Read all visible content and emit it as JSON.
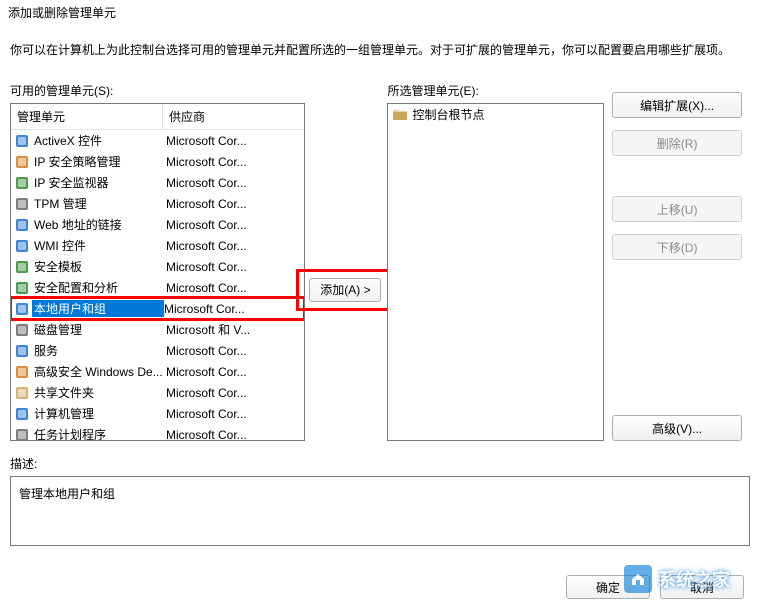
{
  "dialog": {
    "title": "添加或删除管理单元",
    "instruction": "你可以在计算机上为此控制台选择可用的管理单元并配置所选的一组管理单元。对于可扩展的管理单元，你可以配置要启用哪些扩展项。"
  },
  "available": {
    "label": "可用的管理单元(S):",
    "columns": {
      "name": "管理单元",
      "vendor": "供应商"
    },
    "items": [
      {
        "name": "ActiveX 控件",
        "vendor": "Microsoft Cor...",
        "iconColor": "ic-blue"
      },
      {
        "name": "IP 安全策略管理",
        "vendor": "Microsoft Cor...",
        "iconColor": "ic-orange"
      },
      {
        "name": "IP 安全监视器",
        "vendor": "Microsoft Cor...",
        "iconColor": "ic-green"
      },
      {
        "name": "TPM 管理",
        "vendor": "Microsoft Cor...",
        "iconColor": "ic-gray"
      },
      {
        "name": "Web 地址的链接",
        "vendor": "Microsoft Cor...",
        "iconColor": "ic-blue"
      },
      {
        "name": "WMI 控件",
        "vendor": "Microsoft Cor...",
        "iconColor": "ic-blue"
      },
      {
        "name": "安全模板",
        "vendor": "Microsoft Cor...",
        "iconColor": "ic-green"
      },
      {
        "name": "安全配置和分析",
        "vendor": "Microsoft Cor...",
        "iconColor": "ic-green"
      },
      {
        "name": "本地用户和组",
        "vendor": "Microsoft Cor...",
        "iconColor": "ic-blue",
        "selected": true
      },
      {
        "name": "磁盘管理",
        "vendor": "Microsoft 和 V...",
        "iconColor": "ic-gray"
      },
      {
        "name": "服务",
        "vendor": "Microsoft Cor...",
        "iconColor": "ic-blue"
      },
      {
        "name": "高级安全 Windows De...",
        "vendor": "Microsoft Cor...",
        "iconColor": "ic-orange"
      },
      {
        "name": "共享文件夹",
        "vendor": "Microsoft Cor...",
        "iconColor": "ic-folder"
      },
      {
        "name": "计算机管理",
        "vendor": "Microsoft Cor...",
        "iconColor": "ic-blue"
      },
      {
        "name": "任务计划程序",
        "vendor": "Microsoft Cor...",
        "iconColor": "ic-gray"
      }
    ]
  },
  "selected": {
    "label": "所选管理单元(E):",
    "root": "控制台根节点"
  },
  "buttons": {
    "add": "添加(A) >",
    "edit_ext": "编辑扩展(X)...",
    "remove": "删除(R)",
    "move_up": "上移(U)",
    "move_down": "下移(D)",
    "advanced": "高级(V)...",
    "ok": "确定",
    "cancel": "取消"
  },
  "description": {
    "label": "描述:",
    "text": "管理本地用户和组"
  },
  "watermark": {
    "text": "系统之家"
  }
}
